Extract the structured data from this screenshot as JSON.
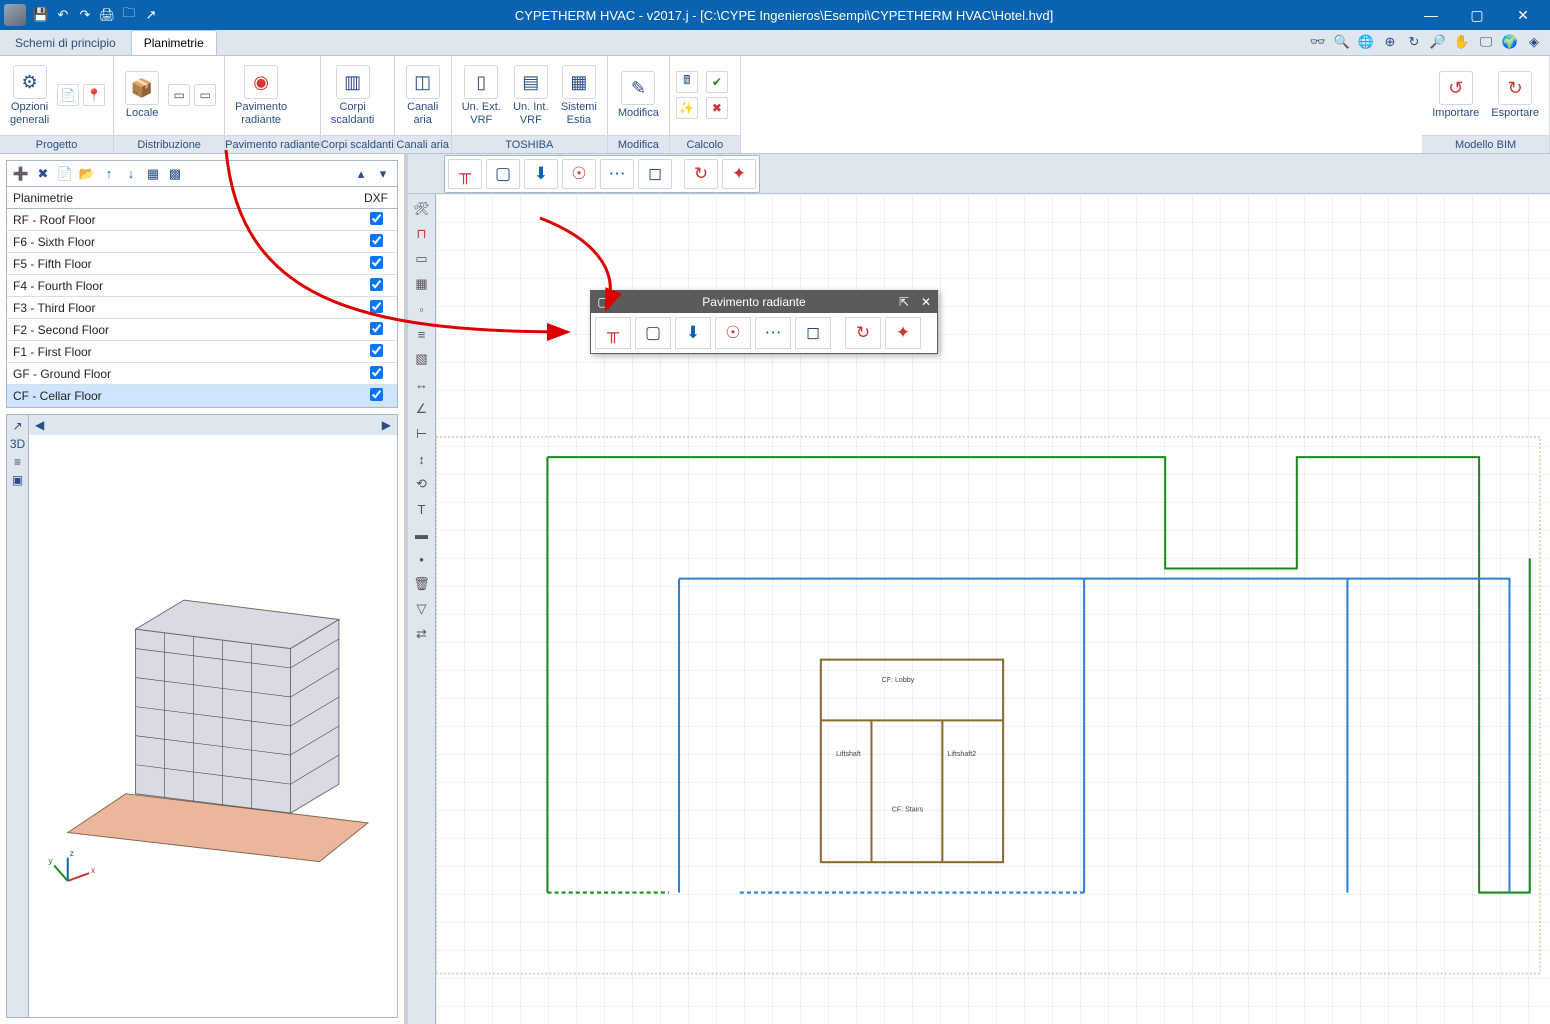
{
  "title": "CYPETHERM HVAC - v2017.j - [C:\\CYPE Ingenieros\\Esempi\\CYPETHERM HVAC\\Hotel.hvd]",
  "tabs": {
    "schemi": "Schemi di principio",
    "plan": "Planimetrie"
  },
  "ribbon": {
    "progetto": "Progetto",
    "distribuzione": "Distribuzione",
    "pavrad": "Pavimento radiante",
    "corpi": "Corpi scaldanti",
    "canali": "Canali aria",
    "toshiba": "TOSHIBA",
    "modifica": "Modifica",
    "calcolo": "Calcolo",
    "modellobim": "Modello BIM",
    "btn": {
      "opzioni": "Opzioni\ngenerali",
      "locale": "Locale",
      "pavimento": "Pavimento\nradiante",
      "corpi": "Corpi\nscaldanti",
      "canali": "Canali\naria",
      "uext": "Un. Ext.\nVRF",
      "uint": "Un. Int.\nVRF",
      "estia": "Sistemi\nEstia",
      "modifica": "Modifica",
      "importare": "Importare",
      "esportare": "Esportare"
    }
  },
  "planpanel": {
    "header": "Planimetrie",
    "dxf": "DXF",
    "rows": [
      {
        "label": "RF - Roof Floor",
        "chk": true
      },
      {
        "label": "F6 - Sixth Floor",
        "chk": true
      },
      {
        "label": "F5 - Fifth Floor",
        "chk": true
      },
      {
        "label": "F4 - Fourth Floor",
        "chk": true
      },
      {
        "label": "F3 - Third Floor",
        "chk": true
      },
      {
        "label": "F2 - Second Floor",
        "chk": true
      },
      {
        "label": "F1 - First Floor",
        "chk": true
      },
      {
        "label": "GF - Ground Floor",
        "chk": true
      },
      {
        "label": "CF - Cellar Floor",
        "chk": true,
        "sel": true
      }
    ]
  },
  "float": {
    "title": "Pavimento radiante"
  }
}
